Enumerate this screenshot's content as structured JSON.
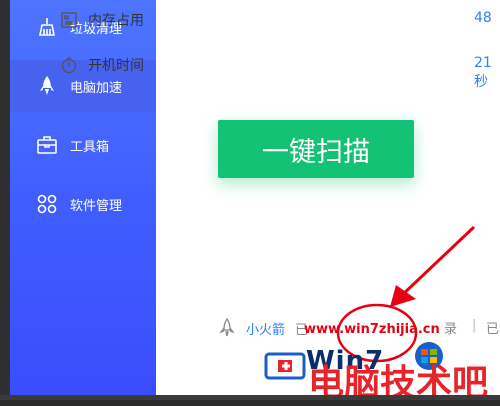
{
  "sidebar": {
    "items": [
      {
        "label": "垃圾清理",
        "icon": "broom-icon"
      },
      {
        "label": "电脑加速",
        "icon": "rocket-icon"
      },
      {
        "label": "工具箱",
        "icon": "toolbox-icon"
      },
      {
        "label": "软件管理",
        "icon": "apps-icon"
      }
    ]
  },
  "info": {
    "memory_label": "内存占用",
    "memory_value": "48",
    "boot_label": "开机时间",
    "boot_value": "21 秒"
  },
  "scan_button_label": "一键扫描",
  "bottom": {
    "rocket_label": "小火箭",
    "text_a": "已",
    "text_b": "录",
    "sep": "|",
    "text_c": "已"
  },
  "watermark": {
    "url": "www.win7zhijia.cn",
    "win7": "Win7",
    "cn": "电脑技术吧"
  },
  "colors": {
    "sidebar_top": "#4e74ff",
    "sidebar_bottom": "#3b4dfd",
    "accent_blue": "#2d82ff",
    "scan_green": "#13c274",
    "watermark_red": "#e50012"
  }
}
